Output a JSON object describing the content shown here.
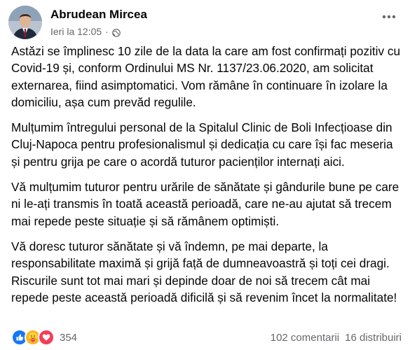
{
  "post": {
    "author": "Abrudean Mircea",
    "timestamp": "Ieri la 12:05",
    "separator": "·",
    "privacy_icon": "globe-icon",
    "more_icon": "more-horizontal-icon",
    "paragraphs": [
      "Astăzi se împlinesc 10 zile de la data la care am fost confirmați pozitiv cu Covid-19 și, conform Ordinului MS Nr. 1137/23.06.2020, am solicitat externarea, fiind asimptomatici. Vom rămâne în continuare în izolare la domiciliu, așa cum prevăd regulile.",
      "Mulțumim întregului personal de la Spitalul Clinic de Boli Infecțioase din Cluj-Napoca pentru profesionalismul și dedicația cu care își fac meseria și pentru grija pe care o acordă tuturor pacienților internați aici.",
      "Vă mulțumim tuturor pentru urările de sănătate și gândurile bune pe care ni le-ați transmis în toată această perioadă, care ne-au ajutat să trecem mai repede peste situație și să rămânem optimiști.",
      "Vă doresc tuturor sănătate și vă îndemn, pe mai departe, la responsabilitate maximă și grijă față de dumneavoastră și toți cei dragi. Riscurile sunt tot mai mari și depinde doar de noi să trecem cât mai repede peste această perioadă dificilă și să revenim încet la normalitate!"
    ]
  },
  "reactions": {
    "icons": [
      "like-icon",
      "care-icon",
      "love-icon"
    ],
    "colors": {
      "like": "#1877f2",
      "care": "#f7b928",
      "love": "#f33e58"
    },
    "count": "354"
  },
  "stats": {
    "comments": "102 comentarii",
    "shares": "16 distribuiri"
  }
}
